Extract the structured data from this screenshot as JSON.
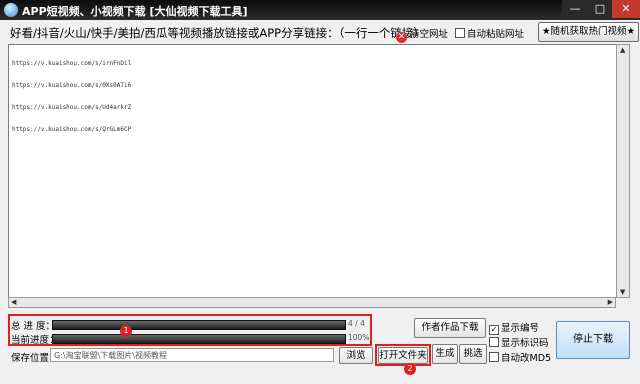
{
  "titlebar": {
    "title": "APP短视频、小视频下载 [大仙视频下载工具]",
    "minimize_label": "—",
    "maximize_label": "□",
    "close_label": "✕"
  },
  "toolbar": {
    "prompt": "好看/抖音/火山/快手/美拍/西瓜等视频播放链接或APP分享链接：（一行一个链接）",
    "clear_label": "清空网址",
    "auto_paste_label": "自动粘贴网址",
    "random_button": "★随机获取热门视频★"
  },
  "textarea": {
    "lines": [
      "https://v.kuaishou.com/s/irnFnDil",
      "https://v.kuaishou.com/s/0Xs0ATi6",
      "https://v.kuaishou.com/s/Ud4arkrZ",
      "https://v.kuaishou.com/s/QrGLm6CP"
    ]
  },
  "progress": {
    "total_label": "总 进 度：",
    "total_value": "4 / 4",
    "total_fraction": 1.0,
    "current_label": "当前进度：",
    "current_value": "100%",
    "current_fraction": 1.0
  },
  "save": {
    "label": "保存位置：",
    "path": "G:\\淘宝联盟\\下载图片\\视频教程",
    "browse_button": "浏览",
    "open_folder_button": "打开文件夹"
  },
  "buttons": {
    "author_download": "作者作品下载",
    "generate": "生成",
    "pick": "挑选",
    "stop_download": "停止下载"
  },
  "options": {
    "show_number": "显示编号",
    "show_number_checked": true,
    "show_marker": "显示标识码",
    "show_marker_checked": false,
    "auto_md5": "自动改MD5",
    "auto_md5_checked": false
  },
  "annotations": {
    "badge_1": "1",
    "badge_2": "2"
  },
  "colors": {
    "annotation_red": "#e02020",
    "stop_button": "#bfe0f6"
  }
}
